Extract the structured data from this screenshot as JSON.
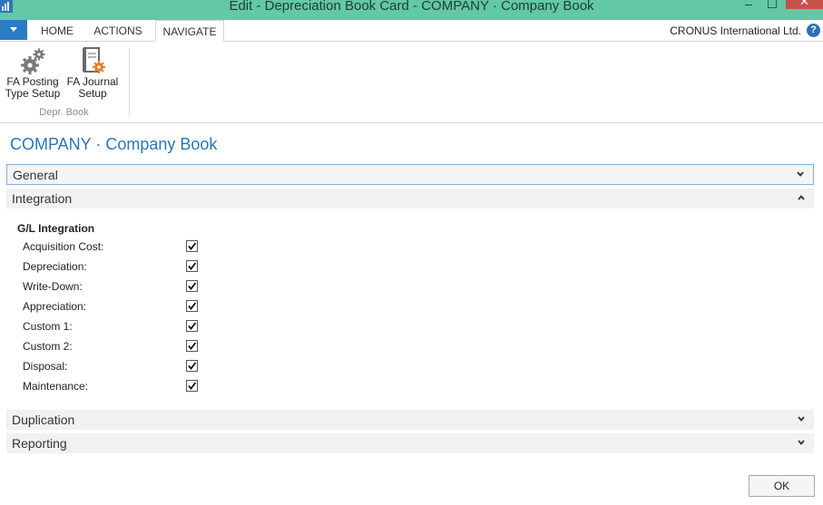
{
  "window": {
    "title": "Edit - Depreciation Book Card - COMPANY · Company Book",
    "minimize_glyph": "–",
    "maximize_glyph": "☐",
    "close_glyph": "✕"
  },
  "ribbon": {
    "tabs": [
      {
        "label": "HOME"
      },
      {
        "label": "ACTIONS"
      },
      {
        "label": "NAVIGATE",
        "active": true
      }
    ],
    "company": "CRONUS International Ltd.",
    "help_glyph": "?",
    "buttons": [
      {
        "line1": "FA Posting",
        "line2": "Type Setup",
        "icon": "gears-icon"
      },
      {
        "line1": "FA Journal",
        "line2": "Setup",
        "icon": "journal-setup-icon"
      }
    ],
    "group_label": "Depr. Book"
  },
  "page": {
    "title": "COMPANY · Company Book"
  },
  "fasttabs": {
    "general": "General",
    "integration": "Integration",
    "duplication": "Duplication",
    "reporting": "Reporting"
  },
  "integration": {
    "group_title": "G/L Integration",
    "fields": [
      {
        "label": "Acquisition Cost:",
        "checked": true
      },
      {
        "label": "Depreciation:",
        "checked": true
      },
      {
        "label": "Write-Down:",
        "checked": true
      },
      {
        "label": "Appreciation:",
        "checked": true
      },
      {
        "label": "Custom 1:",
        "checked": true
      },
      {
        "label": "Custom 2:",
        "checked": true
      },
      {
        "label": "Disposal:",
        "checked": true
      },
      {
        "label": "Maintenance:",
        "checked": true
      }
    ]
  },
  "footer": {
    "ok_label": "OK"
  }
}
